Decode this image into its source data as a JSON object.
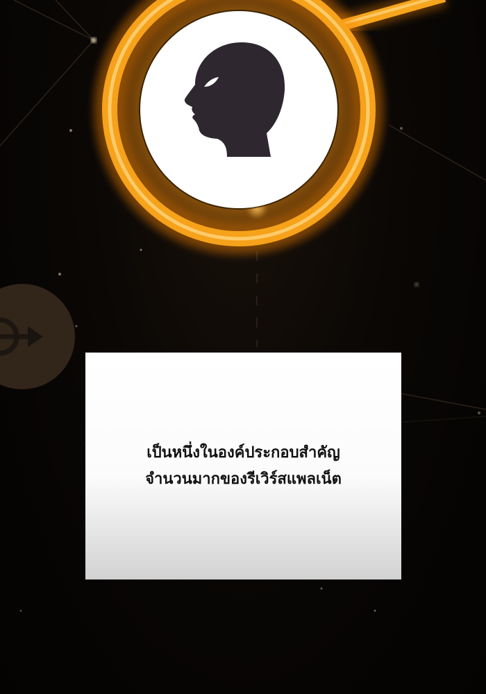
{
  "panel": {
    "caption": {
      "line1": "เป็นหนึ่งในองค์ประกอบสำคัญ",
      "line2": "จำนวนมากของรีเวิร์สแพลเน็ต"
    }
  },
  "icons": {
    "main_node": "human-head-icon",
    "side_node": "arrow-target-icon"
  },
  "colors": {
    "background": "#060403",
    "ring_glow": "#f6a21a",
    "node_fill": "#ffffff",
    "silhouette": "#2e2730",
    "caption_text": "#111111"
  }
}
